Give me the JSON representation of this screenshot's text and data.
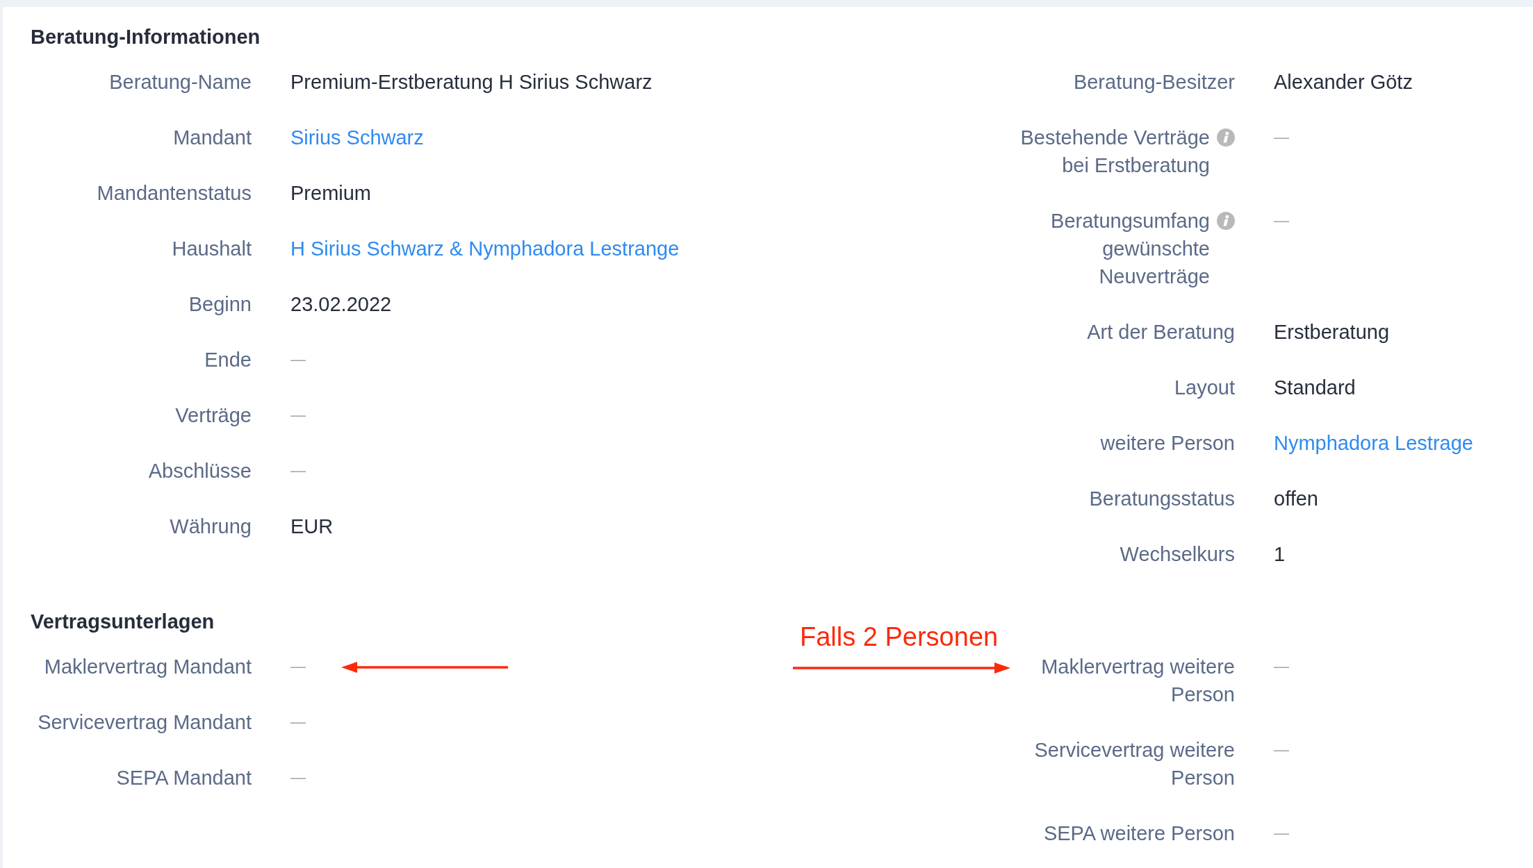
{
  "sections": [
    {
      "title": "Beratung-Informationen",
      "columns": [
        {
          "fields": [
            {
              "label": "Beratung-Name",
              "info": false,
              "kind": "text",
              "value": "Premium-Erstberatung H Sirius Schwarz"
            },
            {
              "label": "Mandant",
              "info": false,
              "kind": "link",
              "value": "Sirius Schwarz"
            },
            {
              "label": "Mandantenstatus",
              "info": false,
              "kind": "text",
              "value": "Premium"
            },
            {
              "label": "Haushalt",
              "info": false,
              "kind": "link",
              "value": "H Sirius Schwarz & Nymphadora Lestrange"
            },
            {
              "label": "Beginn",
              "info": false,
              "kind": "text",
              "value": "23.02.2022"
            },
            {
              "label": "Ende",
              "info": false,
              "kind": "empty",
              "value": "—"
            },
            {
              "label": "Verträge",
              "info": false,
              "kind": "empty",
              "value": "—"
            },
            {
              "label": "Abschlüsse",
              "info": false,
              "kind": "empty",
              "value": "—"
            },
            {
              "label": "Währung",
              "info": false,
              "kind": "text",
              "value": "EUR"
            }
          ]
        },
        {
          "fields": [
            {
              "label": "Beratung-Besitzer",
              "info": false,
              "kind": "text",
              "value": "Alexander Götz"
            },
            {
              "label": "Bestehende Verträge bei Erstberatung",
              "info": true,
              "kind": "empty",
              "value": "—"
            },
            {
              "label": "Beratungsumfang gewünschte Neuverträge",
              "info": true,
              "kind": "empty",
              "value": "—"
            },
            {
              "label": "Art der Beratung",
              "info": false,
              "kind": "text",
              "value": "Erstberatung"
            },
            {
              "label": "Layout",
              "info": false,
              "kind": "text",
              "value": "Standard"
            },
            {
              "label": "weitere Person",
              "info": false,
              "kind": "link",
              "value": "Nymphadora Lestrage"
            },
            {
              "label": "Beratungsstatus",
              "info": false,
              "kind": "text",
              "value": "offen"
            },
            {
              "label": "Wechselkurs",
              "info": false,
              "kind": "text",
              "value": "1"
            }
          ]
        }
      ]
    },
    {
      "title": "Vertragsunterlagen",
      "columns": [
        {
          "fields": [
            {
              "label": "Maklervertrag Mandant",
              "info": false,
              "kind": "empty",
              "value": "—"
            },
            {
              "label": "Servicevertrag Mandant",
              "info": false,
              "kind": "empty",
              "value": "—"
            },
            {
              "label": "SEPA Mandant",
              "info": false,
              "kind": "empty",
              "value": "—"
            }
          ]
        },
        {
          "fields": [
            {
              "label": "Maklervertrag weitere Person",
              "info": false,
              "kind": "empty",
              "value": "—"
            },
            {
              "label": "Servicevertrag weitere Person",
              "info": false,
              "kind": "empty",
              "value": "—"
            },
            {
              "label": "SEPA weitere Person",
              "info": false,
              "kind": "empty",
              "value": "—"
            }
          ]
        }
      ]
    }
  ],
  "annotations": [
    {
      "kind": "note",
      "text": "Falls 2 Personen"
    },
    {
      "kind": "leftarrow"
    },
    {
      "kind": "rightarrow"
    }
  ]
}
